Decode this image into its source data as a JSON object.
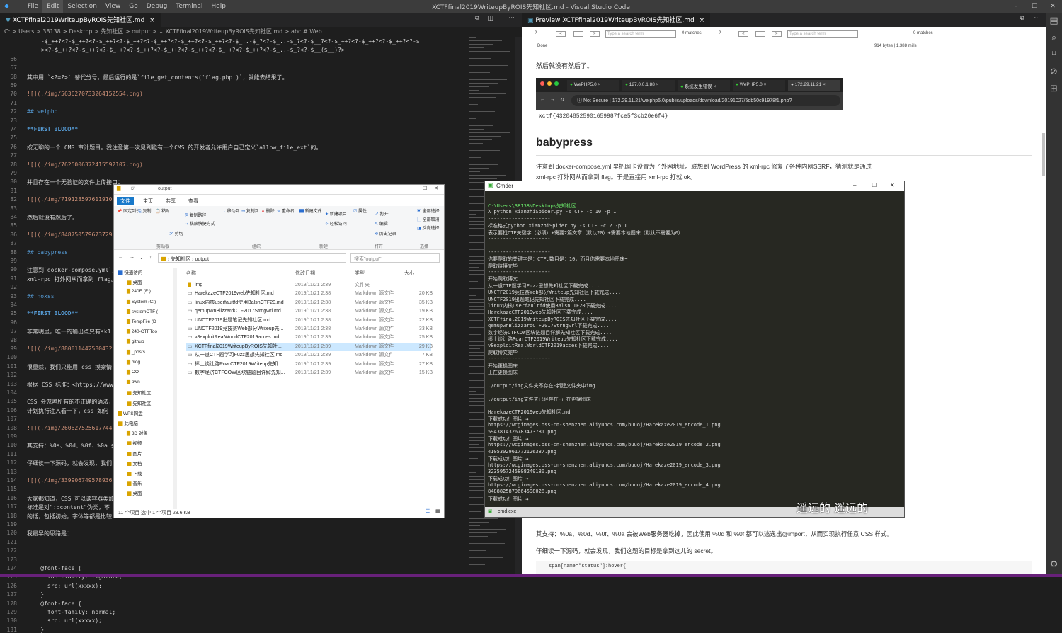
{
  "vscode": {
    "menu": [
      "File",
      "Edit",
      "Selection",
      "View",
      "Go",
      "Debug",
      "Terminal",
      "Help"
    ],
    "title": "XCTFfinal2019WriteupByROIS先知社区.md - Visual Studio Code",
    "left_tab": "XCTFfinal2019WriteupByROIS先知社区.md",
    "preview_tab": "Preview XCTFfinal2019WriteupByROIS先知社区.md",
    "breadcrumb": "C: > Users > 38138 > Desktop > 先知社区 > output > ↓ XCTFfinal2019WriteupByROIS先知社区.md > abc # Web",
    "activity_icons": [
      "files-icon",
      "search-icon",
      "source-control-icon",
      "debug-icon",
      "extensions-icon",
      "settings-icon"
    ]
  },
  "editor_lines": [
    {
      "n": "",
      "t": "-$_++?<?-$_++?<?-$_++?<?-$_++?<?-$_++?<?-$_++?<?-$_++?<?-$_..-$_?<?-$_..-$_?<?-$__?<?-$_++?<?-$_++?<?-$_++?<?-$",
      "c": ""
    },
    {
      "n": "",
      "t": "><?-$_++?<?-$_++?<?-$_++?<?-$_++?<?-$_++?<?-$_++?<?-$_++?<?-$_++?<?-$_..-$_?<?-$__($__)?>",
      "c": ""
    },
    {
      "n": "66",
      "t": "",
      "c": ""
    },
    {
      "n": "67",
      "t": "",
      "c": ""
    },
    {
      "n": "68",
      "t": "其中用 `<?=?>` 替代分号，最后运行的是`file_get_contents('flag.php')`，就能去结果了。",
      "c": ""
    },
    {
      "n": "69",
      "t": "",
      "c": ""
    },
    {
      "n": "70",
      "t": "![](./img/5636270733264152554.png)",
      "c": "c-l"
    },
    {
      "n": "71",
      "t": "",
      "c": ""
    },
    {
      "n": "72",
      "t": "## weiphp",
      "c": "c-h"
    },
    {
      "n": "73",
      "t": "",
      "c": ""
    },
    {
      "n": "74",
      "t": "**FIRST BLOOD**",
      "c": "c-b"
    },
    {
      "n": "75",
      "t": "",
      "c": ""
    },
    {
      "n": "76",
      "t": "按无聊的一个 CMS 审计题目。我注意第一次见到能有一个CMS 的开发者允许用户自己定义`allow_file_ext`的。",
      "c": ""
    },
    {
      "n": "77",
      "t": "",
      "c": ""
    },
    {
      "n": "78",
      "t": "![](./img/7625006372415592107.png)",
      "c": "c-l"
    },
    {
      "n": "79",
      "t": "",
      "c": ""
    },
    {
      "n": "80",
      "t": "并且存在一个无验证的文件上传接口：",
      "c": ""
    },
    {
      "n": "81",
      "t": "",
      "c": ""
    },
    {
      "n": "82",
      "t": "![](./img/719128597611910...",
      "c": "c-l"
    },
    {
      "n": "83",
      "t": "",
      "c": ""
    },
    {
      "n": "84",
      "t": "然后就没有然后了。",
      "c": ""
    },
    {
      "n": "85",
      "t": "",
      "c": ""
    },
    {
      "n": "86",
      "t": "![](./img/848750579673729...",
      "c": "c-l"
    },
    {
      "n": "87",
      "t": "",
      "c": ""
    },
    {
      "n": "88",
      "t": "## babypress",
      "c": "c-h"
    },
    {
      "n": "89",
      "t": "",
      "c": ""
    },
    {
      "n": "90",
      "t": "注意到`docker-compose.yml`里",
      "c": ""
    },
    {
      "n": "91",
      "t": "xml-rpc 打外网从而拿到 flag。",
      "c": ""
    },
    {
      "n": "92",
      "t": "",
      "c": ""
    },
    {
      "n": "93",
      "t": "## noxss",
      "c": "c-h"
    },
    {
      "n": "94",
      "t": "",
      "c": ""
    },
    {
      "n": "95",
      "t": "**FIRST BLOOD**",
      "c": "c-b"
    },
    {
      "n": "96",
      "t": "",
      "c": ""
    },
    {
      "n": "97",
      "t": "非常明显，唯一的输出点只有sk1",
      "c": ""
    },
    {
      "n": "98",
      "t": "",
      "c": ""
    },
    {
      "n": "99",
      "t": "![](./img/880011442580432...",
      "c": "c-l"
    },
    {
      "n": "100",
      "t": "",
      "c": ""
    },
    {
      "n": "101",
      "t": "很显然，我们只能用 css 摸索情",
      "c": ""
    },
    {
      "n": "102",
      "t": "",
      "c": ""
    },
    {
      "n": "103",
      "t": "根据 CSS 标准：<https://www...",
      "c": ""
    },
    {
      "n": "104",
      "t": "",
      "c": ""
    },
    {
      "n": "105",
      "t": "CSS 会忽略所有的不正确的语法，",
      "c": ""
    },
    {
      "n": "106",
      "t": "计划执行注入看一下，css 如何",
      "c": ""
    },
    {
      "n": "107",
      "t": "",
      "c": ""
    },
    {
      "n": "108",
      "t": "![](./img/260627525617744...",
      "c": "c-l"
    },
    {
      "n": "109",
      "t": "",
      "c": ""
    },
    {
      "n": "110",
      "t": "其支持：%0a、%0d、%0f、%0a 会",
      "c": ""
    },
    {
      "n": "111",
      "t": "",
      "c": ""
    },
    {
      "n": "112",
      "t": "仔细读一下源码，就会发现，我们",
      "c": ""
    },
    {
      "n": "113",
      "t": "",
      "c": ""
    },
    {
      "n": "114",
      "t": "![](./img/339906749578936...",
      "c": "c-l"
    },
    {
      "n": "115",
      "t": "",
      "c": ""
    },
    {
      "n": "116",
      "t": "大家都知道，CSS 可以读容器类加",
      "c": ""
    },
    {
      "n": "117",
      "t": "标准是对\"::content\"伪类，不 ...",
      "c": ""
    },
    {
      "n": "118",
      "t": "的话，包括初始，字体等都是比较",
      "c": ""
    },
    {
      "n": "119",
      "t": "",
      "c": ""
    },
    {
      "n": "120",
      "t": "我最早的思路是：",
      "c": ""
    },
    {
      "n": "121",
      "t": "",
      "c": ""
    },
    {
      "n": "122",
      "t": "",
      "c": ""
    },
    {
      "n": "123",
      "t": "",
      "c": ""
    },
    {
      "n": "124",
      "t": "    @font-face {",
      "c": ""
    },
    {
      "n": "125",
      "t": "      font-family: ligature;",
      "c": ""
    },
    {
      "n": "126",
      "t": "      src: url(xxxxx);",
      "c": ""
    },
    {
      "n": "127",
      "t": "    }",
      "c": ""
    },
    {
      "n": "128",
      "t": "    @font-face {",
      "c": ""
    },
    {
      "n": "129",
      "t": "      font-family: normal;",
      "c": ""
    },
    {
      "n": "130",
      "t": "      src: url(xxxxx);",
      "c": ""
    },
    {
      "n": "131",
      "t": "    }",
      "c": ""
    }
  ],
  "preview": {
    "find1": {
      "placeholder": "Type a search term",
      "matches": "0 matches",
      "done": "Done"
    },
    "find2": {
      "placeholder": "Type a search term",
      "matches": "0 matches",
      "size": "914 bytes | 1,388 mills"
    },
    "para_then": "然后就没有然后了。",
    "browser_tabs": [
      "WePHP5.0",
      "127.0.0.1:88",
      "系统发生错误",
      "WePHP5.0",
      "172.29.11.21"
    ],
    "url_secure": "Not Secure",
    "url": "172.29.11.21/weiphp5.0/public/uploads/download/20191027/5db50c91978f1.php?",
    "flag": "xctf{432048525901659987fce5f3cb20e6f4}",
    "h_babypress": "babypress",
    "para_bp1": "注意到 docker-compose.yml 里把网卡设置为了外网地址。联想到 WordPress 的 xml-rpc 修复了各种内网SSRF，猜测就是通过",
    "para_bp2": "xml-rpc 打外网从而拿到 flag。于是直接用 xml-rpc 打就 ok。",
    "para_support": "其支持：%0a、%0d、%0f、%0a 会被Web服务器吃掉，因此使用 %0d 和 %0f 都可以逃逸出@import，从而实现执行任意 CSS 样式。",
    "para_read": "仔细读一下源码，就会发现，我们这题的目标是拿到这儿的 secret。",
    "code_line": "span[name=\"status\"]:hover{"
  },
  "explorer": {
    "title": "output",
    "ribbon_tabs": [
      "文件",
      "主页",
      "共享",
      "查看"
    ],
    "ribbon_groups": [
      "剪贴板",
      "组织",
      "新建",
      "打开",
      "选择"
    ],
    "ribbon_btns": [
      "固定到快速访问",
      "复制",
      "粘贴",
      "剪切",
      "复制路径",
      "粘贴快捷方式",
      "移动到",
      "复制到",
      "删除",
      "重命名",
      "新建文件夹",
      "新建项目",
      "轻松访问",
      "属性",
      "打开",
      "编辑",
      "历史记录",
      "全部选择",
      "全部取消",
      "反向选择"
    ],
    "path": [
      "先知社区",
      "output"
    ],
    "search_placeholder": "搜索\"output\"",
    "col_headers": [
      "名称",
      "修改日期",
      "类型",
      "大小"
    ],
    "nav": [
      "快速访问",
      "桌面",
      "240E (F:)",
      "System (C:)",
      "systemCTF (",
      "TempFile (D",
      "240-CTFToo",
      "github",
      "_posts",
      "blog",
      "OO",
      "pwn",
      "先知社区",
      "先知社区",
      "WPS网盘",
      "此电脑",
      "3D 对象",
      "视频",
      "图片",
      "文档",
      "下载",
      "音乐",
      "桌面"
    ],
    "files": [
      {
        "name": "img",
        "date": "2019/11/21 2:39",
        "type": "文件夹",
        "size": ""
      },
      {
        "name": "HarekazeCTF2019web先知社区.md",
        "date": "2019/11/21 2:38",
        "type": "Markdown 源文件",
        "size": "20 KB"
      },
      {
        "name": "linux内核userfaultfd使用BalsnCTF20.md",
        "date": "2019/11/21 2:38",
        "type": "Markdown 源文件",
        "size": "35 KB"
      },
      {
        "name": "qemupwnBlizzardCTF2017Strngwrl.md",
        "date": "2019/11/21 2:38",
        "type": "Markdown 源文件",
        "size": "19 KB"
      },
      {
        "name": "UNCTF2019出题笔记先知社区.md",
        "date": "2019/11/21 2:38",
        "type": "Markdown 源文件",
        "size": "22 KB"
      },
      {
        "name": "UNCTF2019竞技赛Web部分Writeup先...",
        "date": "2019/11/21 2:38",
        "type": "Markdown 源文件",
        "size": "33 KB"
      },
      {
        "name": "v8exploitRealWorldCTF2019acces.md",
        "date": "2019/11/21 2:39",
        "type": "Markdown 源文件",
        "size": "25 KB"
      },
      {
        "name": "XCTFfinal2019WriteupByROIS先知社...",
        "date": "2019/11/21 2:39",
        "type": "Markdown 源文件",
        "size": "29 KB"
      },
      {
        "name": "从一道CTF题学习Fuzz思想先知社区.md",
        "date": "2019/11/21 2:39",
        "type": "Markdown 源文件",
        "size": "7 KB"
      },
      {
        "name": "棒上谈让路RoarCTF2019Writeup先知...",
        "date": "2019/11/21 2:39",
        "type": "Markdown 源文件",
        "size": "27 KB"
      },
      {
        "name": "数字经济CTFCOW区块链题目详解先知...",
        "date": "2019/11/21 2:39",
        "type": "Markdown 源文件",
        "size": "15 KB"
      }
    ],
    "status": "11 个项目    选中 1 个项目  28.6 KB"
  },
  "cmder": {
    "title": "Cmder",
    "footer": "cmd.exe",
    "lines": [
      {
        "t": "C:\\Users\\38138\\Desktop\\先知社区",
        "g": true
      },
      {
        "t": "λ python xianzhiSpider.py -s CTF -c 10 -p 1",
        "g": false
      },
      {
        "t": "---------------------",
        "g": false
      },
      {
        "t": "标准格式python xianzhiSpider.py -s CTF -c 2 -p 1",
        "g": false
      },
      {
        "t": "表示要找CTF关键字（必须）+需要2篇文章（默认20）+需要本地图床（默认不需要为0）",
        "g": false
      },
      {
        "t": "---------------------",
        "g": false
      },
      {
        "t": "",
        "g": false
      },
      {
        "t": "---------------------",
        "g": false
      },
      {
        "t": "你要爬取的关键字是：CTF,数目是：10，而且你需要本地图床~",
        "g": false
      },
      {
        "t": "爬取链接完毕",
        "g": false
      },
      {
        "t": "---------------------",
        "g": false
      },
      {
        "t": "开始爬取博文",
        "g": false
      },
      {
        "t": "从一道CTF题学习Fuzz思想先知社区下载完成....",
        "g": false
      },
      {
        "t": "UNCTF2019竞技赛Web部分Writeup先知社区下载完成....",
        "g": false
      },
      {
        "t": "UNCTF2019出题笔记先知社区下载完成....",
        "g": false
      },
      {
        "t": "linux内核userfaultfd使用BalsnCTF20下载完成....",
        "g": false
      },
      {
        "t": "HarekazeCTF2019web先知社区下载完成....",
        "g": false
      },
      {
        "t": "XCTFfinal2019WriteupByROIS先知社区下载完成....",
        "g": false
      },
      {
        "t": "qemupwnBlizzardCTF2017Strngwrl下载完成....",
        "g": false
      },
      {
        "t": "数字经济CTFCOW区块链题目详解先知社区下载完成....",
        "g": false
      },
      {
        "t": "棒上谈让路RoarCTF2019Writeup先知社区下载完成....",
        "g": false
      },
      {
        "t": "v8exploitRealWorldCTF2019acces下载完成....",
        "g": false
      },
      {
        "t": "爬取博文完毕",
        "g": false
      },
      {
        "t": "---------------------",
        "g": false
      },
      {
        "t": "开始更换图床",
        "g": false
      },
      {
        "t": "正在更换图床",
        "g": false
      },
      {
        "t": "",
        "g": false
      },
      {
        "t": "./output/img文件夹不存在-新建文件夹中img",
        "g": false
      },
      {
        "t": "",
        "g": false
      },
      {
        "t": "./output/img文件夹已经存在-正在更换图床",
        "g": false
      },
      {
        "t": "",
        "g": false
      },
      {
        "t": "HarekazeCTF2019web先知社区.md",
        "g": false
      },
      {
        "t": "下载成功！图片 →",
        "g": false
      },
      {
        "t": "https://wcgimages.oss-cn-shenzhen.aliyuncs.com/buuoj/Harekaze2019_encode_1.png",
        "g": false
      },
      {
        "t": "5943814326783473781.png",
        "g": false
      },
      {
        "t": "下载成功！图片 →",
        "g": false
      },
      {
        "t": "https://wcgimages.oss-cn-shenzhen.aliyuncs.com/buuoj/Harekaze2019_encode_2.png",
        "g": false
      },
      {
        "t": "4105302961772126387.png",
        "g": false
      },
      {
        "t": "下载成功！图片 →",
        "g": false
      },
      {
        "t": "https://wcgimages.oss-cn-shenzhen.aliyuncs.com/buuoj/Harekaze2019_encode_3.png",
        "g": false
      },
      {
        "t": "3235957245808249180.png",
        "g": false
      },
      {
        "t": "下载成功！图片 →",
        "g": false
      },
      {
        "t": "https://wcgimages.oss-cn-shenzhen.aliyuncs.com/buuoj/Harekaze2019_encode_4.png",
        "g": false
      },
      {
        "t": "8488825879664598028.png",
        "g": false
      },
      {
        "t": "下载成功！图片 →",
        "g": false
      }
    ]
  },
  "subtitle": "遥远的 遥远的"
}
